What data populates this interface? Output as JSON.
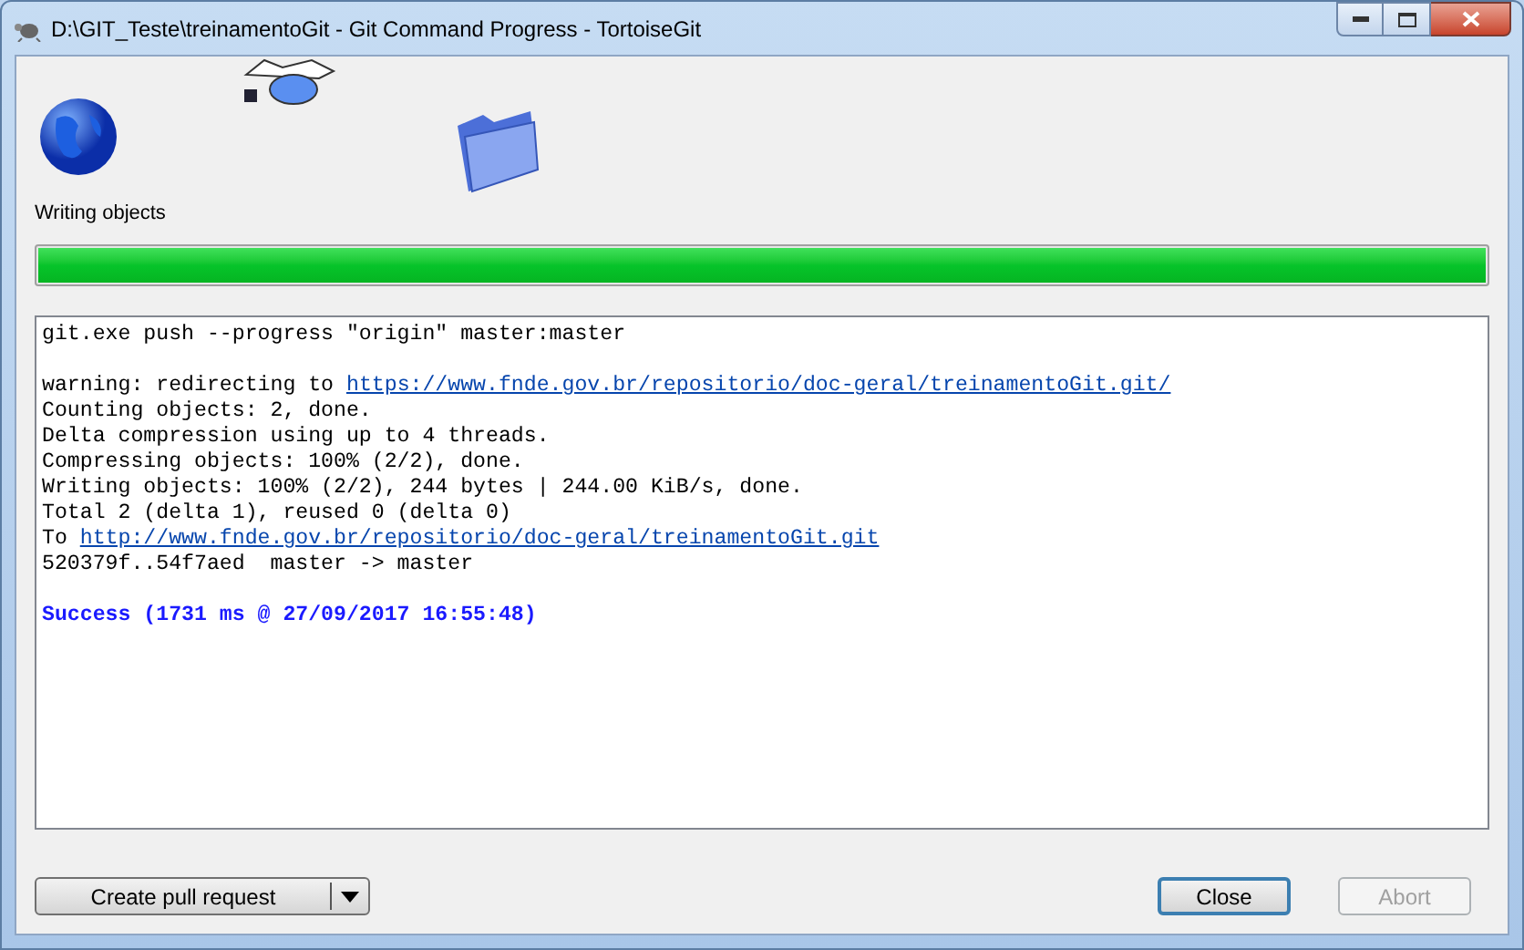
{
  "window": {
    "title": "D:\\GIT_Teste\\treinamentoGit - Git Command Progress - TortoiseGit"
  },
  "animation": {
    "caption": "Writing objects"
  },
  "progress": {
    "level": 1
  },
  "log": [
    {
      "kind": "command",
      "text": "git.exe push --progress \"origin\" master:master"
    },
    {
      "kind": "gap"
    },
    {
      "kind": "text",
      "text": "warning: redirecting to ",
      "link": "https://www.fnde.gov.br/repositorio/doc-geral/treinamentoGit.git/"
    },
    {
      "kind": "text",
      "text": "Counting objects: 2, done."
    },
    {
      "kind": "text",
      "text": "Delta compression using up to 4 threads."
    },
    {
      "kind": "text",
      "text": "Compressing objects: 100% (2/2), done."
    },
    {
      "kind": "text",
      "text": "Writing objects: 100% (2/2), 244 bytes | 244.00 KiB/s, done."
    },
    {
      "kind": "text",
      "text": "Total 2 (delta 1), reused 0 (delta 0)"
    },
    {
      "kind": "text",
      "text": "To ",
      "link": "http://www.fnde.gov.br/repositorio/doc-geral/treinamentoGit.git"
    },
    {
      "kind": "text",
      "text": "520379f..54f7aed  master -> master"
    },
    {
      "kind": "gap"
    },
    {
      "kind": "success",
      "text": "Success (1731 ms @ 27/09/2017 16:55:48)"
    }
  ],
  "buttons": {
    "pull_request": "Create pull request",
    "close": {
      "label": "Close",
      "default": true,
      "disabled": false
    },
    "abort": {
      "label": "Abort",
      "disabled": true
    }
  }
}
